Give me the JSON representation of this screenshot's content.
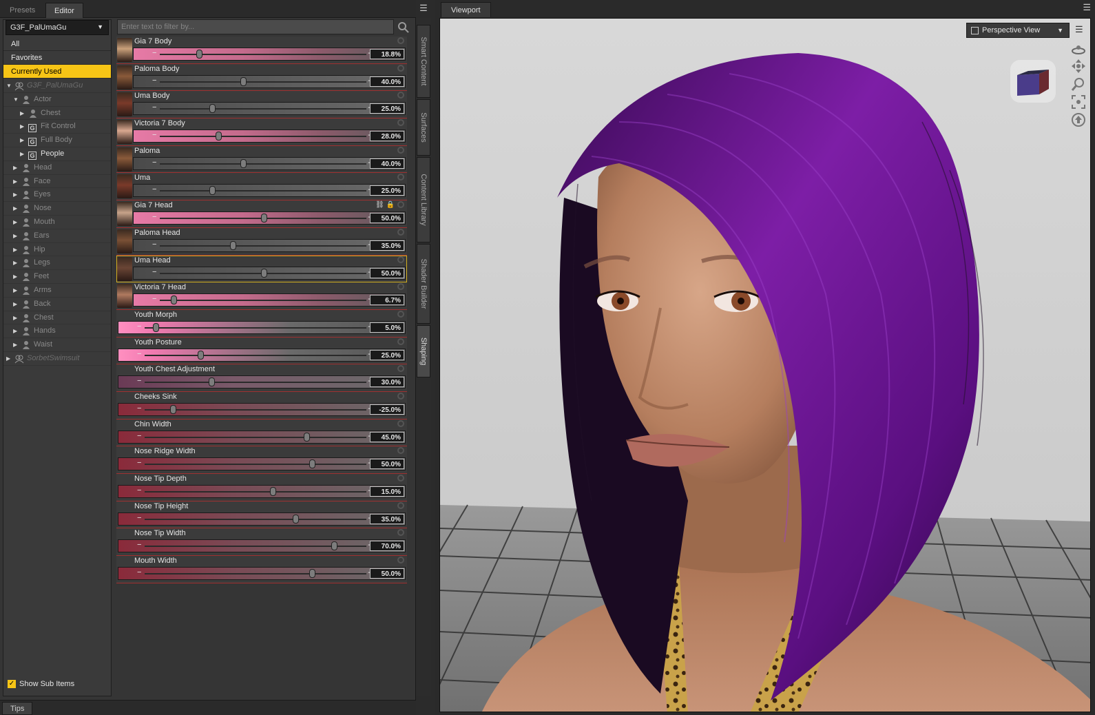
{
  "tabs": {
    "presets": "Presets",
    "editor": "Editor"
  },
  "figure_select": {
    "value": "G3F_PalUmaGu"
  },
  "categories": [
    {
      "label": "All",
      "selected": false
    },
    {
      "label": "Favorites",
      "selected": false
    },
    {
      "label": "Currently Used",
      "selected": true
    }
  ],
  "tree": [
    {
      "label": "G3F_PalUmaGu",
      "indent": 0,
      "expanded": true,
      "icon": "figure-icon",
      "style": "dim"
    },
    {
      "label": "Actor",
      "indent": 1,
      "expanded": true,
      "icon": "person-icon",
      "style": "normal"
    },
    {
      "label": "Chest",
      "indent": 2,
      "expanded": false,
      "icon": "person-icon",
      "style": "normal"
    },
    {
      "label": "Fit Control",
      "indent": 2,
      "expanded": false,
      "icon": "group-icon",
      "style": "normal"
    },
    {
      "label": "Full Body",
      "indent": 2,
      "expanded": false,
      "icon": "group-icon",
      "style": "normal"
    },
    {
      "label": "People",
      "indent": 2,
      "expanded": false,
      "icon": "group-icon",
      "style": "bright"
    },
    {
      "label": "Head",
      "indent": 1,
      "expanded": false,
      "icon": "person-icon",
      "style": "normal"
    },
    {
      "label": "Face",
      "indent": 1,
      "expanded": false,
      "icon": "person-icon",
      "style": "normal"
    },
    {
      "label": "Eyes",
      "indent": 1,
      "expanded": false,
      "icon": "person-icon",
      "style": "normal"
    },
    {
      "label": "Nose",
      "indent": 1,
      "expanded": false,
      "icon": "person-icon",
      "style": "normal"
    },
    {
      "label": "Mouth",
      "indent": 1,
      "expanded": false,
      "icon": "person-icon",
      "style": "normal"
    },
    {
      "label": "Ears",
      "indent": 1,
      "expanded": false,
      "icon": "person-icon",
      "style": "normal"
    },
    {
      "label": "Hip",
      "indent": 1,
      "expanded": false,
      "icon": "person-icon",
      "style": "normal"
    },
    {
      "label": "Legs",
      "indent": 1,
      "expanded": false,
      "icon": "person-icon",
      "style": "normal"
    },
    {
      "label": "Feet",
      "indent": 1,
      "expanded": false,
      "icon": "person-icon",
      "style": "normal"
    },
    {
      "label": "Arms",
      "indent": 1,
      "expanded": false,
      "icon": "person-icon",
      "style": "normal"
    },
    {
      "label": "Back",
      "indent": 1,
      "expanded": false,
      "icon": "person-icon",
      "style": "normal"
    },
    {
      "label": "Chest",
      "indent": 1,
      "expanded": false,
      "icon": "person-icon",
      "style": "normal"
    },
    {
      "label": "Hands",
      "indent": 1,
      "expanded": false,
      "icon": "person-icon",
      "style": "normal"
    },
    {
      "label": "Waist",
      "indent": 1,
      "expanded": false,
      "icon": "person-icon",
      "style": "normal"
    },
    {
      "label": "SorbetSwimsuit",
      "indent": 0,
      "expanded": false,
      "icon": "figure-icon",
      "style": "dim"
    }
  ],
  "show_sub_items": {
    "label": "Show Sub Items",
    "checked": true
  },
  "filter": {
    "placeholder": "Enter text to filter by..."
  },
  "params": [
    {
      "name": "Gia 7 Body",
      "value": "18.8%",
      "fraction": 0.188,
      "fill": "pink",
      "thumb": "#c9a07a"
    },
    {
      "name": "Paloma Body",
      "value": "40.0%",
      "fraction": 0.4,
      "fill": "dark",
      "thumb": "#8a5a3a"
    },
    {
      "name": "Uma Body",
      "value": "25.0%",
      "fraction": 0.25,
      "fill": "dark",
      "thumb": "#7a3a2a"
    },
    {
      "name": "Victoria 7 Body",
      "value": "28.0%",
      "fraction": 0.28,
      "fill": "pink",
      "thumb": "#d9a890"
    },
    {
      "name": "Paloma",
      "value": "40.0%",
      "fraction": 0.4,
      "fill": "dark",
      "thumb": "#8a5a3a"
    },
    {
      "name": "Uma",
      "value": "25.0%",
      "fraction": 0.25,
      "fill": "dark",
      "thumb": "#7a3a2a"
    },
    {
      "name": "Gia 7 Head",
      "value": "50.0%",
      "fraction": 0.5,
      "fill": "pink",
      "thumb": "#c7a38a",
      "locked": true
    },
    {
      "name": "Paloma Head",
      "value": "35.0%",
      "fraction": 0.35,
      "fill": "dark",
      "thumb": "#7a5035"
    },
    {
      "name": "Uma Head",
      "value": "50.0%",
      "fraction": 0.5,
      "fill": "dark",
      "thumb": "#6a4535",
      "highlighted": true
    },
    {
      "name": "Victoria 7 Head",
      "value": "6.7%",
      "fraction": 0.067,
      "fill": "pink",
      "thumb": "#b07a60"
    },
    {
      "name": "Youth Morph",
      "value": "5.0%",
      "fraction": 0.05,
      "fill": "pinkfull",
      "thumb": ""
    },
    {
      "name": "Youth Posture",
      "value": "25.0%",
      "fraction": 0.25,
      "fill": "pinkfull",
      "thumb": ""
    },
    {
      "name": "Youth Chest Adjustment",
      "value": "30.0%",
      "fraction": 0.3,
      "fill": "mauve",
      "thumb": ""
    },
    {
      "name": "Cheeks Sink",
      "value": "-25.0%",
      "fraction": 0.125,
      "fill": "red",
      "thumb": ""
    },
    {
      "name": "Chin Width",
      "value": "45.0%",
      "fraction": 0.725,
      "fill": "red",
      "thumb": ""
    },
    {
      "name": "Nose Ridge Width",
      "value": "50.0%",
      "fraction": 0.75,
      "fill": "red",
      "thumb": ""
    },
    {
      "name": "Nose Tip Depth",
      "value": "15.0%",
      "fraction": 0.575,
      "fill": "red",
      "thumb": ""
    },
    {
      "name": "Nose Tip Height",
      "value": "35.0%",
      "fraction": 0.675,
      "fill": "red",
      "thumb": ""
    },
    {
      "name": "Nose Tip Width",
      "value": "70.0%",
      "fraction": 0.85,
      "fill": "red",
      "thumb": ""
    },
    {
      "name": "Mouth Width",
      "value": "50.0%",
      "fraction": 0.75,
      "fill": "red",
      "thumb": ""
    }
  ],
  "side_tabs": [
    "Smart Content",
    "Surfaces",
    "Content Library",
    "Shader Builder",
    "Shaping"
  ],
  "bottom": {
    "tips": "Tips"
  },
  "viewport": {
    "tab": "Viewport",
    "camera": "Perspective View"
  },
  "colors": {
    "accent": "#f7c516",
    "hair": "#6a1a8a",
    "skin": "#c08a68",
    "floor": "#8a8a8a"
  }
}
